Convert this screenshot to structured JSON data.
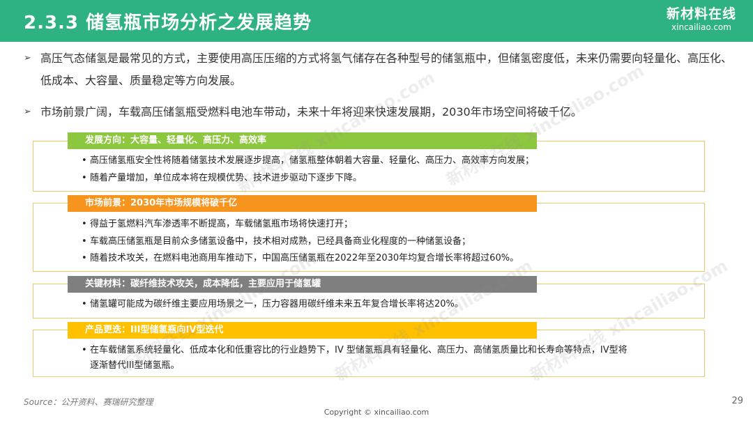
{
  "header": {
    "title": "2.3.3 储氢瓶市场分析之发展趋势",
    "logo_cn": "新材料在线",
    "logo_url": "xincailiao.com"
  },
  "bullets": [
    "高压气态储氢是最常见的方式，主要使用高压压缩的方式将氢气储存在各种型号的储氢瓶中，但储氢密度低，未来仍需要向轻量化、高压化、低成本、大容量、质量稳定等方向发展。",
    "市场前景广阔，车载高压储氢瓶受燃料电池车带动，未来十年将迎来快速发展期，2030年市场空间将破千亿。"
  ],
  "sections": [
    {
      "tag": "发展方向：大容量、轻量化、高压力、高效率",
      "color": "#8dc63f",
      "items": [
        "高压储氢瓶安全性将随着储氢技术发展逐步提高，储氢瓶整体朝着大容量、轻量化、高压力、高效率方向发展；",
        "随着产量增加，单位成本将在规模优势、技术进步驱动下逐步下降。"
      ]
    },
    {
      "tag": "市场前景：2030年市场规模将破千亿",
      "color": "#f7941d",
      "items": [
        "得益于氢燃料汽车渗透率不断提高，车载储氢瓶市场将快速打开；",
        "车载高压储氢瓶是目前众多储氢设备中，技术相对成熟，已经具备商业化程度的一种储氢设备；",
        "随着技术攻关，在燃料电池商用车推动下，中国高压储氢瓶在2022年至2030年均复合增长率将超过60%。"
      ]
    },
    {
      "tag": "关键材料：碳纤维技术攻关，成本降低，主要应用于储氢罐",
      "color": "#7f7f7f",
      "items": [
        "储氢罐可能成为碳纤维主要应用场景之一，压力容器用碳纤维未来五年复合增长率将达20%。"
      ]
    },
    {
      "tag": "产品更迭：III型储氢瓶向IV型迭代",
      "color": "#ffc000",
      "items": [
        "在车载储氢系统轻量化、低成本化和低重容比的行业趋势下，IV 型储氢瓶具有轻量化、高压力、高储氢质量比和长寿命等特点，IV型将",
        "逐渐替代III型储氢瓶。"
      ]
    }
  ],
  "footer": {
    "source": "Source：公开资料、赛瑞研究整理",
    "copyright": "Copyright © xincailiao.com",
    "page_number": "29"
  },
  "watermark": "新材料在线 xincailiao.com",
  "icons": {
    "bullet": "arrow-right-icon",
    "item": "dot-icon"
  }
}
